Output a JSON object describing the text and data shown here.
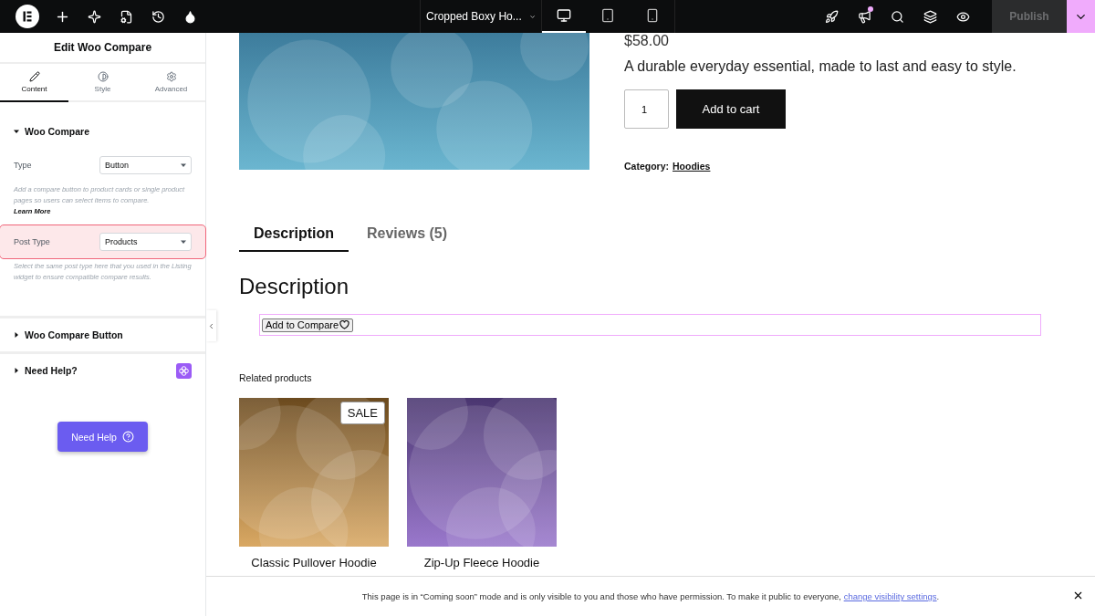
{
  "topbar": {
    "document_title": "Cropped Boxy Ho...",
    "devices": [
      {
        "kind": "desktop",
        "selected": true
      },
      {
        "kind": "tablet",
        "selected": false
      },
      {
        "kind": "mobile",
        "selected": false
      }
    ],
    "whats_new_dot": true,
    "publish": {
      "label": "Publish",
      "disabled": true
    }
  },
  "panel": {
    "title": "Edit Woo Compare",
    "tabs": [
      {
        "kind": "content",
        "label": "Content",
        "selected": true
      },
      {
        "kind": "style",
        "label": "Style",
        "selected": false
      },
      {
        "kind": "advanced",
        "label": "Advanced",
        "selected": false
      }
    ],
    "sections": [
      {
        "title": "Woo Compare",
        "expanded": true,
        "fields": [
          {
            "label": "Type",
            "value": "Button",
            "highlighted": false,
            "help": "Add a compare button to product cards or single product pages so users can select items to compare.",
            "help_link": "Learn More"
          },
          {
            "label": "Post Type",
            "value": "Products",
            "highlighted": true,
            "help": "Select the same post type here that you used in the Listing widget to ensure compatible compare results."
          }
        ]
      },
      {
        "title": "Woo Compare Button",
        "expanded": false
      },
      {
        "title": "Need Help?",
        "expanded": false,
        "badge": true
      }
    ],
    "help_button": "Need Help"
  },
  "product": {
    "price": "$58.00",
    "description": "A durable everyday essential, made to last and easy to style.",
    "quantity": "1",
    "add_to_cart": "Add to cart",
    "category_label": "Category:",
    "category": "Hoodies",
    "tabs": [
      {
        "label": "Description",
        "selected": true
      },
      {
        "label": "Reviews (5)",
        "selected": false
      }
    ],
    "section_heading": "Description",
    "compare_button": "Add to Compare",
    "related_heading": "Related products",
    "related": [
      {
        "title": "Classic Pullover Hoodie",
        "badge": "SALE"
      },
      {
        "title": "Zip-Up Fleece Hoodie"
      }
    ]
  },
  "notice": {
    "text": "This page is in “Coming soon” mode and is only visible to you and those who have permission. To make it public to everyone, ",
    "link": "change visibility settings",
    "end": "."
  }
}
